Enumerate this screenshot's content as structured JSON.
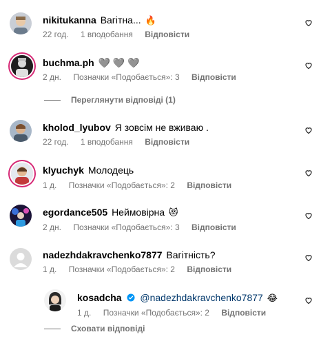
{
  "comments": [
    {
      "username": "nikitukanna",
      "text": "Вагітна...",
      "emoji": "🔥",
      "time": "22 год.",
      "likes": "1 вподобання",
      "reply": "Відповісти"
    },
    {
      "username": "buchma.ph",
      "text": "🩶 🩶 🩶",
      "time": "2 дн.",
      "likes": "Позначки «Подобається»: 3",
      "reply": "Відповісти",
      "view_replies": "Переглянути відповіді (1)"
    },
    {
      "username": "kholod_lyubov",
      "text": "Я зовсім не вживаю .",
      "time": "22 год.",
      "likes": "1 вподобання",
      "reply": "Відповісти"
    },
    {
      "username": "klyuchyk",
      "text": "Молодець",
      "time": "1 д.",
      "likes": "Позначки «Подобається»: 2",
      "reply": "Відповісти"
    },
    {
      "username": "egordance505",
      "text": "Неймовірна",
      "emoji": "😻",
      "time": "2 дн.",
      "likes": "Позначки «Подобається»: 3",
      "reply": "Відповісти"
    },
    {
      "username": "nadezhdakravchenko7877",
      "text": "Вагітність?",
      "time": "1 д.",
      "likes": "Позначки «Подобається»: 2",
      "reply": "Відповісти"
    }
  ],
  "nested_reply": {
    "username": "kosadcha",
    "mention": "@nadezhdakravchenko7877",
    "emoji": "😂",
    "time": "1 д.",
    "likes": "Позначки «Подобається»: 2",
    "reply": "Відповісти",
    "hide_replies": "Сховати відповіді"
  },
  "colors": {
    "meta_gray": "#737373",
    "mention_blue": "#00376b",
    "verified_blue": "#0095f6",
    "story_ring": "#d62976"
  }
}
